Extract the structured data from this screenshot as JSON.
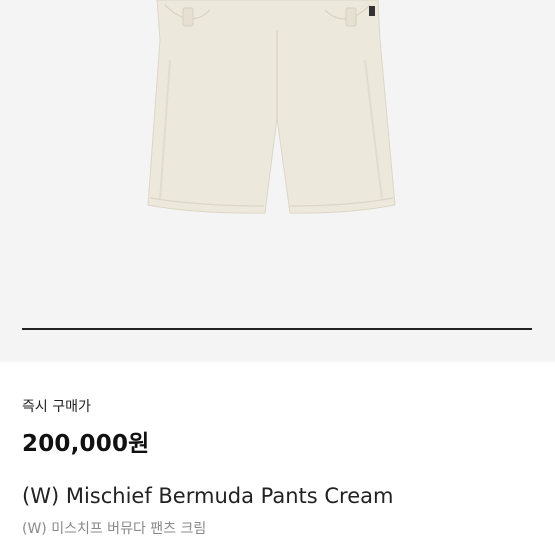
{
  "product": {
    "image_alt": "cream bermuda shorts product photo",
    "gallery_progress": 1.0,
    "price_label": "즉시 구매가",
    "price": "200,000원",
    "name_en": "(W) Mischief Bermuda Pants Cream",
    "name_ko": "(W) 미스치프 버뮤다 팬츠 크림"
  },
  "colors": {
    "image_background": "#f4f4f4",
    "shorts_fabric": "#ede8dc",
    "progress_fill": "#222222",
    "progress_track": "#dcdcdc",
    "secondary_text": "#8a8a8a"
  }
}
